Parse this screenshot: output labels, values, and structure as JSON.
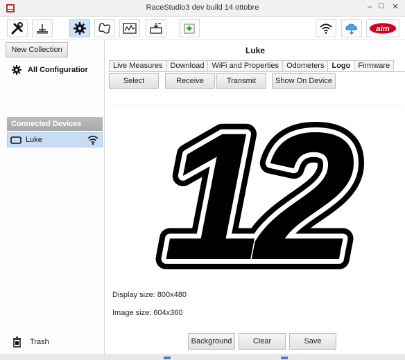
{
  "window": {
    "title": "RaceStudio3 dev  build 14 ottobre",
    "min_glyph": "–",
    "max_glyph": "☐",
    "close_glyph": "✕"
  },
  "toolbar": {
    "items": [
      {
        "icon": "tools-icon"
      },
      {
        "icon": "calibrate-icon"
      },
      {
        "icon": "configuration-icon",
        "active": true
      },
      {
        "icon": "track-icon"
      },
      {
        "icon": "analysis-icon"
      },
      {
        "icon": "data-download-icon"
      },
      {
        "icon": "import-export-icon"
      }
    ],
    "right_items": [
      {
        "icon": "wifi-icon"
      },
      {
        "icon": "cloud-icon"
      },
      {
        "icon": "aim-logo-icon"
      }
    ],
    "brand_logo_text": "aim"
  },
  "sidebar": {
    "new_collection_label": "New Collection",
    "all_configurations_label": "All Configuratior",
    "connected_devices_label": "Connected Devices",
    "devices": [
      {
        "name": "Luke"
      }
    ],
    "trash_label": "Trash"
  },
  "main": {
    "device_title": "Luke",
    "tabs": [
      {
        "label": "Live Measures",
        "active": false
      },
      {
        "label": "Download",
        "active": false
      },
      {
        "label": "WiFi and Properties",
        "active": false
      },
      {
        "label": "Odometers",
        "active": false
      },
      {
        "label": "Logo",
        "active": true
      },
      {
        "label": "Firmware",
        "active": false
      }
    ],
    "actions": {
      "select_label": "Select",
      "receive_label": "Receive",
      "transmit_label": "Transmit",
      "show_on_device_label": "Show On Device"
    },
    "logo_text": "12",
    "display_size_label": "Display size: 800x480",
    "image_size_label": "Image size: 604x360",
    "bottom": {
      "background_label": "Background",
      "clear_label": "Clear",
      "save_label": "Save"
    }
  },
  "colors": {
    "accent": "#cfe3f7",
    "brand_red": "#d4001c",
    "header_gray": "#a8a8a8",
    "selected_row": "#c8ddf4"
  }
}
